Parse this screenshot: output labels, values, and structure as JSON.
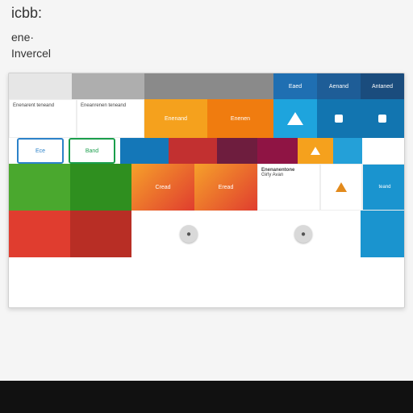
{
  "header": {
    "title": "icbb:",
    "line1": "ene·",
    "line2": "Invercel"
  },
  "row1": {
    "tab1": "Eaed",
    "tab2": "Aenand",
    "tab3": "Antaned"
  },
  "row2": {
    "card1": "Enenarent\nteneand",
    "card2": "Eneanrenen\nteneand",
    "tile1": "Enenand",
    "tile2": "Enenen"
  },
  "row3": {
    "chip1": "Ece",
    "chip2": "Band"
  },
  "row4": {
    "grad1": "Cread",
    "grad2": "Eread",
    "info_title": "Enenanentone",
    "info_sub": "Girly Avan",
    "side": "teand"
  }
}
